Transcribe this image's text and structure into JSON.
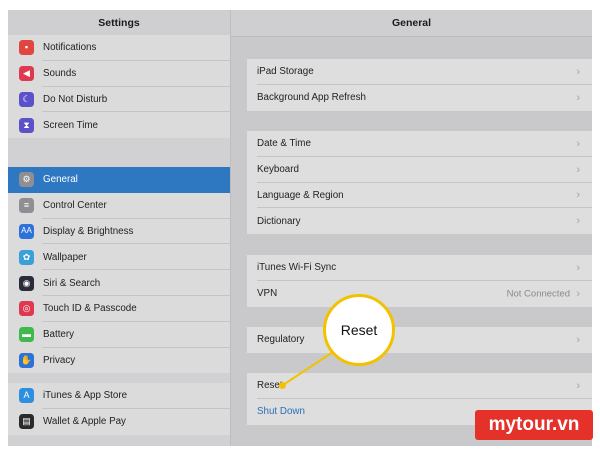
{
  "sidebar": {
    "title": "Settings",
    "groups": [
      [
        {
          "label": "Notifications",
          "icon": "notifications-icon",
          "color": "#e0453e"
        },
        {
          "label": "Sounds",
          "icon": "sounds-icon",
          "color": "#e0394f"
        },
        {
          "label": "Do Not Disturb",
          "icon": "moon-icon",
          "color": "#5b52c9"
        },
        {
          "label": "Screen Time",
          "icon": "hourglass-icon",
          "color": "#5b52c9"
        }
      ],
      [
        {
          "label": "General",
          "icon": "gear-icon",
          "color": "#8e8e93",
          "selected": true
        },
        {
          "label": "Control Center",
          "icon": "control-center-icon",
          "color": "#8e8e93"
        },
        {
          "label": "Display & Brightness",
          "icon": "display-icon",
          "color": "#2d72d9"
        },
        {
          "label": "Wallpaper",
          "icon": "wallpaper-icon",
          "color": "#3aa0d8"
        },
        {
          "label": "Siri & Search",
          "icon": "siri-icon",
          "color": "#2b2b3a"
        },
        {
          "label": "Touch ID & Passcode",
          "icon": "fingerprint-icon",
          "color": "#e0394f"
        },
        {
          "label": "Battery",
          "icon": "battery-icon",
          "color": "#3fb84e"
        },
        {
          "label": "Privacy",
          "icon": "hand-icon",
          "color": "#2d72d9"
        }
      ],
      [
        {
          "label": "iTunes & App Store",
          "icon": "app-store-icon",
          "color": "#2d8fe0"
        },
        {
          "label": "Wallet & Apple Pay",
          "icon": "wallet-icon",
          "color": "#2b2b2b"
        }
      ]
    ]
  },
  "main": {
    "title": "General",
    "groups": [
      [
        {
          "label": "iPad Storage"
        },
        {
          "label": "Background App Refresh"
        }
      ],
      [
        {
          "label": "Date & Time"
        },
        {
          "label": "Keyboard"
        },
        {
          "label": "Language & Region"
        },
        {
          "label": "Dictionary"
        }
      ],
      [
        {
          "label": "iTunes Wi-Fi Sync"
        },
        {
          "label": "VPN",
          "value": "Not Connected"
        }
      ],
      [
        {
          "label": "Regulatory"
        }
      ],
      [
        {
          "label": "Reset"
        },
        {
          "label": "Shut Down",
          "link": true
        }
      ]
    ]
  },
  "callout": {
    "label": "Reset"
  },
  "watermark": "mytour.vn",
  "colors": {
    "accent": "#2e78c2",
    "highlight": "#f2c200",
    "brand": "#e4322b"
  }
}
